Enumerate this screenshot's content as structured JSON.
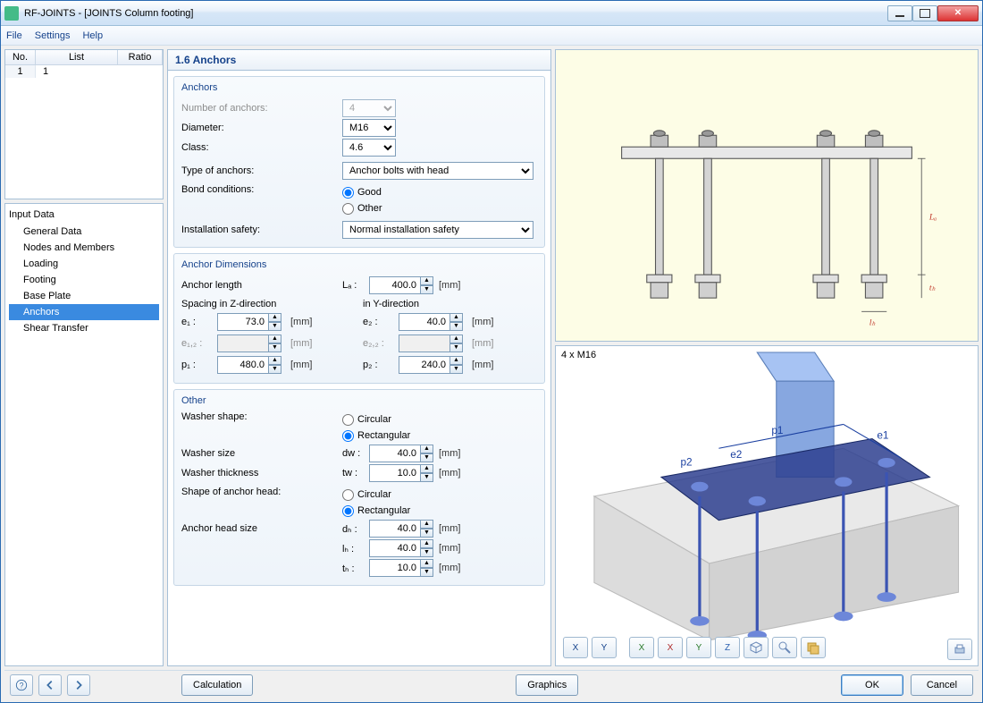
{
  "title": "RF-JOINTS - [JOINTS Column footing]",
  "menu": {
    "file": "File",
    "settings": "Settings",
    "help": "Help"
  },
  "grid": {
    "h_no": "No.",
    "h_list": "List",
    "h_ratio": "Ratio",
    "row": {
      "no": "1",
      "list": "1",
      "ratio": ""
    }
  },
  "tree": {
    "root": "Input Data",
    "i1": "General Data",
    "i2": "Nodes and Members",
    "i3": "Loading",
    "i4": "Footing",
    "i5": "Base Plate",
    "i6": "Anchors",
    "i7": "Shear Transfer"
  },
  "form_title": "1.6 Anchors",
  "groups": {
    "anchors": "Anchors",
    "dims": "Anchor Dimensions",
    "other": "Other"
  },
  "labels": {
    "num_anchors": "Number of anchors:",
    "diameter": "Diameter:",
    "class": "Class:",
    "type": "Type of anchors:",
    "bond": "Bond conditions:",
    "good": "Good",
    "other": "Other",
    "install": "Installation safety:",
    "anchor_len": "Anchor length",
    "La": "Lₐ :",
    "spacingZ": "Spacing in Z-direction",
    "spacingY": "in Y-direction",
    "e1": "e₁ :",
    "e12": "e₁,₂ :",
    "p1": "p₁ :",
    "e2": "e₂ :",
    "e22": "e₂,₂ :",
    "p2": "p₂ :",
    "mm": "[mm]",
    "washer_shape": "Washer shape:",
    "circular": "Circular",
    "rectangular": "Rectangular",
    "washer_size": "Washer size",
    "dw": "dw :",
    "washer_thk": "Washer thickness",
    "tw": "tw :",
    "head_shape": "Shape of anchor head:",
    "head_size": "Anchor head size",
    "dh": "dₕ :",
    "lh": "lₕ :",
    "th": "tₕ :"
  },
  "values": {
    "num_anchors": "4",
    "diameter": "M16",
    "class": "4.6",
    "type": "Anchor bolts with head",
    "install": "Normal installation safety",
    "La": "400.0",
    "e1": "73.0",
    "e12": "",
    "p1": "480.0",
    "e2": "40.0",
    "e22": "",
    "p2": "240.0",
    "dw": "40.0",
    "tw": "10.0",
    "dh": "40.0",
    "lh": "40.0",
    "th": "10.0"
  },
  "imglabel": "4 x M16",
  "dim": {
    "La": "Lₐ",
    "th": "tₕ",
    "lh": "lₕ",
    "e1": "e1",
    "e2": "e2",
    "p1": "p1",
    "p2": "p2"
  },
  "buttons": {
    "calc": "Calculation",
    "graphics": "Graphics",
    "ok": "OK",
    "cancel": "Cancel"
  },
  "view_btns": {
    "b1": "X",
    "b2": "Y",
    "b3": "X",
    "b4": "X",
    "b5": "Y",
    "b6": "Z"
  }
}
